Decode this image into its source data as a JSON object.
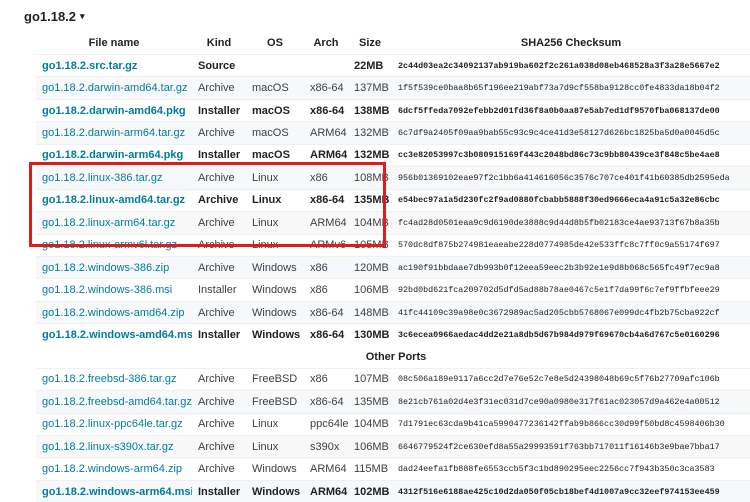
{
  "version_header": {
    "label": "go1.18.2",
    "caret": "▾"
  },
  "columns": [
    "File name",
    "Kind",
    "OS",
    "Arch",
    "Size",
    "SHA256 Checksum"
  ],
  "featured_rows": [
    {
      "file": "go1.18.2.src.tar.gz",
      "kind": "Source",
      "os": "",
      "arch": "",
      "size": "22MB",
      "sha": "2c44d03ea2c34092137ab919ba602f2c261a038d08eb468528a3f3a28e5667e2",
      "featured": true
    },
    {
      "file": "go1.18.2.darwin-amd64.tar.gz",
      "kind": "Archive",
      "os": "macOS",
      "arch": "x86-64",
      "size": "137MB",
      "sha": "1f5f539ce0baa8b65f196ee219abf73a7d9cf558ba9128cc0fe4833da18b04f2",
      "featured": false
    },
    {
      "file": "go1.18.2.darwin-amd64.pkg",
      "kind": "Installer",
      "os": "macOS",
      "arch": "x86-64",
      "size": "138MB",
      "sha": "6dcf5ffeda7092efebb2d01fd36f8a0b0aa87e5ab7ed1df9570fba068137de00",
      "featured": true
    },
    {
      "file": "go1.18.2.darwin-arm64.tar.gz",
      "kind": "Archive",
      "os": "macOS",
      "arch": "ARM64",
      "size": "132MB",
      "sha": "6c7df9a2405f09aa9bab55c93c9c4ce41d3e58127d626bc1825ba5d0a0045d5c",
      "featured": false
    },
    {
      "file": "go1.18.2.darwin-arm64.pkg",
      "kind": "Installer",
      "os": "macOS",
      "arch": "ARM64",
      "size": "132MB",
      "sha": "cc3e82053997c3b080915169f443c2048bd86c73c9bb80439ce3f848c5be4ae8",
      "featured": true
    },
    {
      "file": "go1.18.2.linux-386.tar.gz",
      "kind": "Archive",
      "os": "Linux",
      "arch": "x86",
      "size": "108MB",
      "sha": "956b01369102eae97f2c1bb6a414616056c3576c707ce401f41b60385db2595eda",
      "featured": false
    },
    {
      "file": "go1.18.2.linux-amd64.tar.gz",
      "kind": "Archive",
      "os": "Linux",
      "arch": "x86-64",
      "size": "135MB",
      "sha": "e54bec97a1a5d230fc2f9ad0880fcbabb5888f30ed9666eca4a91c5a32e86cbc",
      "featured": true
    },
    {
      "file": "go1.18.2.linux-arm64.tar.gz",
      "kind": "Archive",
      "os": "Linux",
      "arch": "ARM64",
      "size": "104MB",
      "sha": "fc4ad28d0501eaa9c9d6190de3888c9d44d8b5fb02183ce4ae93713f67b8a35b",
      "featured": false
    },
    {
      "file": "go1.18.2.linux-armv6l.tar.gz",
      "kind": "Archive",
      "os": "Linux",
      "arch": "ARMv6",
      "size": "105MB",
      "sha": "570dc8df875b274981eaeabe228d0774985de42e533ffc8c7ff0c9a55174f697",
      "featured": false
    },
    {
      "file": "go1.18.2.windows-386.zip",
      "kind": "Archive",
      "os": "Windows",
      "arch": "x86",
      "size": "120MB",
      "sha": "ac190f91bbdaae7db993b0f12eea59eec2b3b92e1e9d8b068c565fc49f7ec9a8",
      "featured": false
    },
    {
      "file": "go1.18.2.windows-386.msi",
      "kind": "Installer",
      "os": "Windows",
      "arch": "x86",
      "size": "106MB",
      "sha": "92bd0bd621fca209702d5dfd5ad88b78ae0467c5e1f7da99f6c7ef9ffbfeee29",
      "featured": false
    },
    {
      "file": "go1.18.2.windows-amd64.zip",
      "kind": "Archive",
      "os": "Windows",
      "arch": "x86-64",
      "size": "148MB",
      "sha": "41fc44109c39a98e0c3672989ac5ad205cbb5768067e099dc4fb2b75cba922cf",
      "featured": false
    },
    {
      "file": "go1.18.2.windows-amd64.msi",
      "kind": "Installer",
      "os": "Windows",
      "arch": "x86-64",
      "size": "130MB",
      "sha": "3c6ecea0966aedac4dd2e21a8db5d67b984d979f69670cb4a6d767c5e0160296",
      "featured": true
    }
  ],
  "other_ports_title": "Other Ports",
  "other_rows": [
    {
      "file": "go1.18.2.freebsd-386.tar.gz",
      "kind": "Archive",
      "os": "FreeBSD",
      "arch": "x86",
      "size": "107MB",
      "sha": "08c506a189e9117a6cc2d7e76e52c7e8e5d24398048b69c5f76b27709afc106b",
      "featured": false
    },
    {
      "file": "go1.18.2.freebsd-amd64.tar.gz",
      "kind": "Archive",
      "os": "FreeBSD",
      "arch": "x86-64",
      "size": "135MB",
      "sha": "8e21cb761a02d4e3f31ec031d7ce90a0980e317f61ac023057d9a462e4a00512",
      "featured": false
    },
    {
      "file": "go1.18.2.linux-ppc64le.tar.gz",
      "kind": "Archive",
      "os": "Linux",
      "arch": "ppc64le",
      "size": "104MB",
      "sha": "7d1791ec63cda9b41ca5990477236142ffab9b866cc30d99f50bd8c4598406b30",
      "featured": false
    },
    {
      "file": "go1.18.2.linux-s390x.tar.gz",
      "kind": "Archive",
      "os": "Linux",
      "arch": "s390x",
      "size": "106MB",
      "sha": "6646779524f2ce630efd8a55a29993591f763bb717011f16146b3e9bae7bba17",
      "featured": false
    },
    {
      "file": "go1.18.2.windows-arm64.zip",
      "kind": "Archive",
      "os": "Windows",
      "arch": "ARM64",
      "size": "115MB",
      "sha": "dad24eefa1fb888fe6553ccb5f3c1bd890295eec2256cc7f943b350c3ca3583",
      "featured": false
    },
    {
      "file": "go1.18.2.windows-arm64.msi",
      "kind": "Installer",
      "os": "Windows",
      "arch": "ARM64",
      "size": "102MB",
      "sha": "4312f516e6188ae425c10d2da050f05cb18bef4d1007a9cc32eef974153ee459",
      "featured": true
    }
  ],
  "colors": {
    "link": "#007d9c",
    "highlight_border": "#d91e1e",
    "alt_row": "#f7f8f9"
  },
  "icons": {
    "caret": "caret-down-icon"
  }
}
